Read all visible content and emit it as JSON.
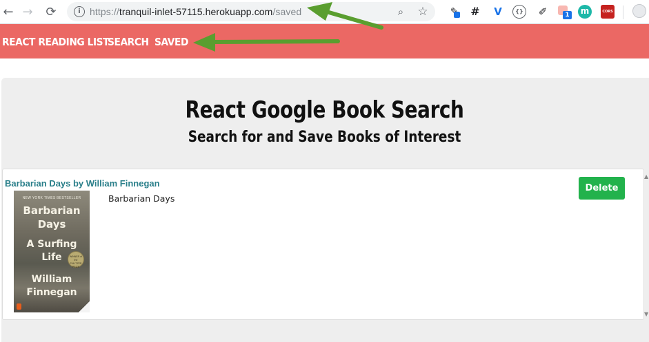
{
  "browser": {
    "back_icon": "←",
    "forward_icon": "→",
    "reload_icon": "⟳",
    "info_icon": "i",
    "url_scheme": "https://",
    "url_host": "tranquil-inlet-57115.herokuapp.com",
    "url_path": "/saved",
    "zoom_icon": "⌕",
    "star_icon": "☆",
    "extensions": [
      {
        "name": "eyedropper-ext-icon",
        "glyph": "✎",
        "color": "#1a73e8"
      },
      {
        "name": "hash-ext-icon",
        "glyph": "#",
        "color": "#1a73e8"
      },
      {
        "name": "vue-ext-icon",
        "glyph": "V",
        "color": "#1a73e8"
      },
      {
        "name": "code-ext-icon",
        "glyph": "{}",
        "color": "#5f6368"
      },
      {
        "name": "picker-ext-icon",
        "glyph": "✐",
        "color": "#1a73e8"
      },
      {
        "name": "badge-ext-icon",
        "glyph": "1",
        "color": "#ea4335"
      },
      {
        "name": "m-ext-icon",
        "glyph": "m",
        "color": "#1db8a8"
      },
      {
        "name": "cors-ext-icon",
        "glyph": "CORS",
        "color": "#c5221f"
      }
    ]
  },
  "navbar": {
    "brand": "REACT READING LIST",
    "search": "SEARCH",
    "saved": "SAVED",
    "bg_color": "#eb6864"
  },
  "jumbotron": {
    "title": "React Google Book Search",
    "subtitle": "Search for and Save Books of Interest"
  },
  "books": [
    {
      "heading": "Barbarian Days by William Finnegan",
      "description": "Barbarian Days",
      "delete_label": "Delete",
      "cover": {
        "bestseller": "NEW YORK TIMES BESTSELLER",
        "line1": "Barbarian",
        "line2": "Days",
        "line3": "A Surfing",
        "line4": "Life",
        "author1": "William",
        "author2": "Finnegan",
        "seal": "WINNER of the PULITZER PRIZE"
      }
    }
  ],
  "colors": {
    "accent": "#eb6864",
    "delete": "#22b24c",
    "title_link": "#2a7f8a",
    "annotation_arrow": "#5a9e2f"
  }
}
